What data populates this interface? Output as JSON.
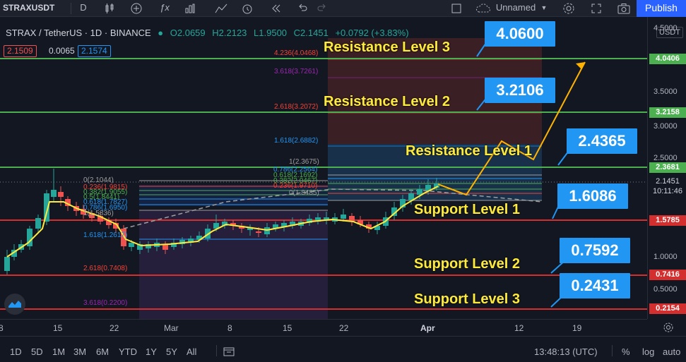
{
  "toolbar": {
    "symbol": "STRAXUSDT",
    "interval": "D",
    "layout_name": "Unnamed",
    "publish_label": "Publish"
  },
  "legend": {
    "title": "STRAX / TetherUS · 1D · BINANCE",
    "open": "O2.0659",
    "high": "H2.2123",
    "low": "L1.9500",
    "close": "C2.1451",
    "change": "+0.0792 (+3.83%)",
    "sell": "2.1509",
    "spread": "0.0065",
    "buy": "2.1574"
  },
  "levels": {
    "resistance_3": "Resistance Level 3",
    "resistance_2": "Resistance Level 2",
    "resistance_1": "Resistance Level 1",
    "support_1": "Support Level 1",
    "support_2": "Support Level 2",
    "support_3": "Support Level 3"
  },
  "callouts": {
    "r3": "4.0600",
    "r2": "3.2106",
    "r1": "2.4365",
    "s1": "1.6086",
    "s2": "0.7592",
    "s3": "0.2431"
  },
  "fib_right": [
    "4.236(4.0468)",
    "3.618(3.7261)",
    "2.618(3.2072)",
    "1.618(2.6882)",
    "1(2.3675)",
    "0.786(2.2564)",
    "0.618(2.1692)",
    "0.382(2.0467)",
    "0.236(1.9710)",
    "0(1.8485)"
  ],
  "fib_left": [
    "0(2.1044)",
    "0.236(1.9815)",
    "0.382(1.9055)",
    "0.5(1.8441)",
    "0.618(1.7827)",
    "0.786(1.6950)",
    "1(1.5836)",
    "1.618(1.2617)",
    "2.618(0.7408)",
    "3.618(0.2200)"
  ],
  "price_scale": {
    "currency": "USDT",
    "ticks": [
      "4.5000",
      "3.5000",
      "3.0000",
      "2.5000",
      "1.0000",
      "0.5000"
    ],
    "badges": {
      "r3": "4.0406",
      "r2": "3.2158",
      "r1": "2.3681",
      "last": "2.1451",
      "countdown": "10:11:46",
      "s1": "1.5785",
      "s2": "0.7416",
      "s3": "0.2154"
    },
    "colors": {
      "green": "#4caf50",
      "red": "#d32f2f",
      "up": "#26a69a",
      "down": "#ef5350",
      "accent": "#2196f3",
      "label": "#ffeb3b"
    }
  },
  "time_axis": [
    "8",
    "15",
    "22",
    "Mar",
    "8",
    "15",
    "22",
    "Apr",
    "12",
    "19"
  ],
  "bottom_bar": {
    "ranges": [
      "1D",
      "5D",
      "1M",
      "3M",
      "6M",
      "YTD",
      "1Y",
      "5Y",
      "All"
    ],
    "clock": "13:48:13 (UTC)",
    "percent": "%",
    "log": "log",
    "auto": "auto"
  }
}
